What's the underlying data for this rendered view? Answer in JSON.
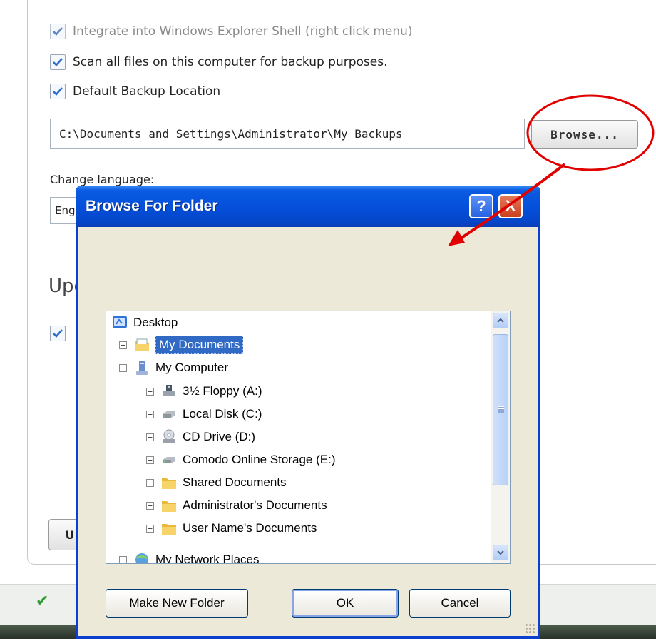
{
  "settings": {
    "options": [
      {
        "label": "Integrate into Windows Explorer Shell (right click menu)",
        "checked": true
      },
      {
        "label": "Scan all files on this computer for backup purposes.",
        "checked": true
      },
      {
        "label": "Default Backup Location",
        "checked": true
      }
    ],
    "backup_path": "C:\\Documents and Settings\\Administrator\\My Backups",
    "browse_label": "Browse...",
    "language_label": "Change language:",
    "language_value": "English",
    "updates_heading": "Updates",
    "updates_checkbox_checked": true,
    "bottom_button_label": "U"
  },
  "dialog": {
    "title": "Browse For Folder",
    "help_label": "?",
    "close_label": "X",
    "tree": [
      {
        "label": "Desktop",
        "icon": "desktop-icon",
        "expander": ""
      },
      {
        "label": "My Documents",
        "icon": "my-documents-icon",
        "expander": "+",
        "selected": true
      },
      {
        "label": "My Computer",
        "icon": "my-computer-icon",
        "expander": "−"
      },
      {
        "label": "3½ Floppy (A:)",
        "icon": "floppy-drive-icon",
        "expander": "+"
      },
      {
        "label": "Local Disk (C:)",
        "icon": "hard-disk-icon",
        "expander": "+"
      },
      {
        "label": "CD Drive (D:)",
        "icon": "cd-drive-icon",
        "expander": "+"
      },
      {
        "label": "Comodo Online Storage (E:)",
        "icon": "network-drive-icon",
        "expander": "+"
      },
      {
        "label": "Shared Documents",
        "icon": "folder-icon",
        "expander": "+"
      },
      {
        "label": "Administrator's Documents",
        "icon": "folder-icon",
        "expander": "+"
      },
      {
        "label": "User Name's Documents",
        "icon": "folder-icon",
        "expander": "+"
      },
      {
        "label": "My Network Places",
        "icon": "network-places-icon",
        "expander": "+"
      }
    ],
    "buttons": {
      "make_new_folder": "Make New Folder",
      "ok": "OK",
      "cancel": "Cancel"
    }
  },
  "annotation_color": "#e00000",
  "accent_color": "#0550dc"
}
